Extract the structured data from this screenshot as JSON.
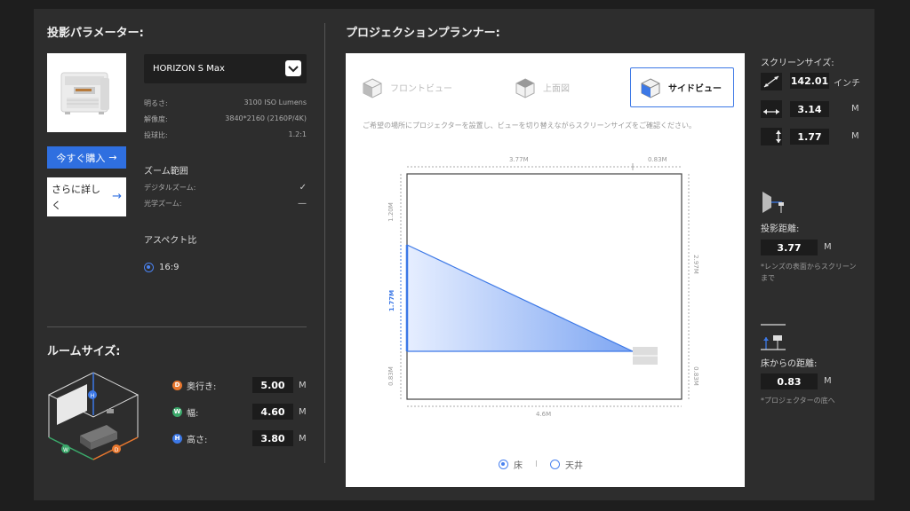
{
  "params": {
    "title": "投影パラメーター:",
    "model": "HORIZON S Max",
    "specs": [
      {
        "label": "明るさ:",
        "value": "3100 ISO Lumens"
      },
      {
        "label": "解像度:",
        "value": "3840*2160 (2160P/4K)"
      },
      {
        "label": "投球比:",
        "value": "1.2:1"
      }
    ],
    "buy_label": "今すぐ購入",
    "more_label": "さらに詳しく",
    "zoom": {
      "title": "ズーム範囲",
      "digital_label": "デジタルズーム:",
      "digital_value": "✓",
      "optical_label": "光学ズーム:",
      "optical_value": "—"
    },
    "aspect": {
      "title": "アスペクト比",
      "option": "16:9"
    }
  },
  "room": {
    "title": "ルームサイズ:",
    "dims": [
      {
        "badge": "D",
        "label": "奥行き:",
        "value": "5.00",
        "unit": "M",
        "color": "#e8772e"
      },
      {
        "badge": "W",
        "label": "幅:",
        "value": "4.60",
        "unit": "M",
        "color": "#3aa86a"
      },
      {
        "badge": "H",
        "label": "高さ:",
        "value": "3.80",
        "unit": "M",
        "color": "#3c78e6"
      }
    ]
  },
  "planner": {
    "title": "プロジェクションプランナー:",
    "tabs": [
      {
        "label": "フロントビュー",
        "active": false
      },
      {
        "label": "上面図",
        "active": false
      },
      {
        "label": "サイドビュー",
        "active": true
      }
    ],
    "hint": "ご希望の場所にプロジェクターを設置し、ビューを切り替えながらスクリーンサイズをご確認ください。",
    "diagram": {
      "top_a": "3.77M",
      "top_b": "0.83M",
      "left_top": "1.20M",
      "left_mid": "1.77M",
      "left_bot": "0.83M",
      "right_top": "2.97M",
      "right_bot": "0.83M",
      "bottom": "4.6M"
    },
    "mount": {
      "floor": "床",
      "ceiling": "天井"
    }
  },
  "screen": {
    "title": "スクリーンサイズ:",
    "diag_value": "142.01",
    "diag_unit": "インチ",
    "width_value": "3.14",
    "width_unit": "M",
    "height_value": "1.77",
    "height_unit": "M"
  },
  "throw": {
    "title": "投影距離:",
    "value": "3.77",
    "unit": "M",
    "note": "*レンズの表面からスクリーンまで"
  },
  "floor": {
    "title": "床からの距離:",
    "value": "0.83",
    "unit": "M",
    "note": "*プロジェクターの底へ"
  },
  "colors": {
    "accent": "#3c78e6",
    "panel": "#2d2d2d",
    "bg": "#1e1e1e"
  }
}
